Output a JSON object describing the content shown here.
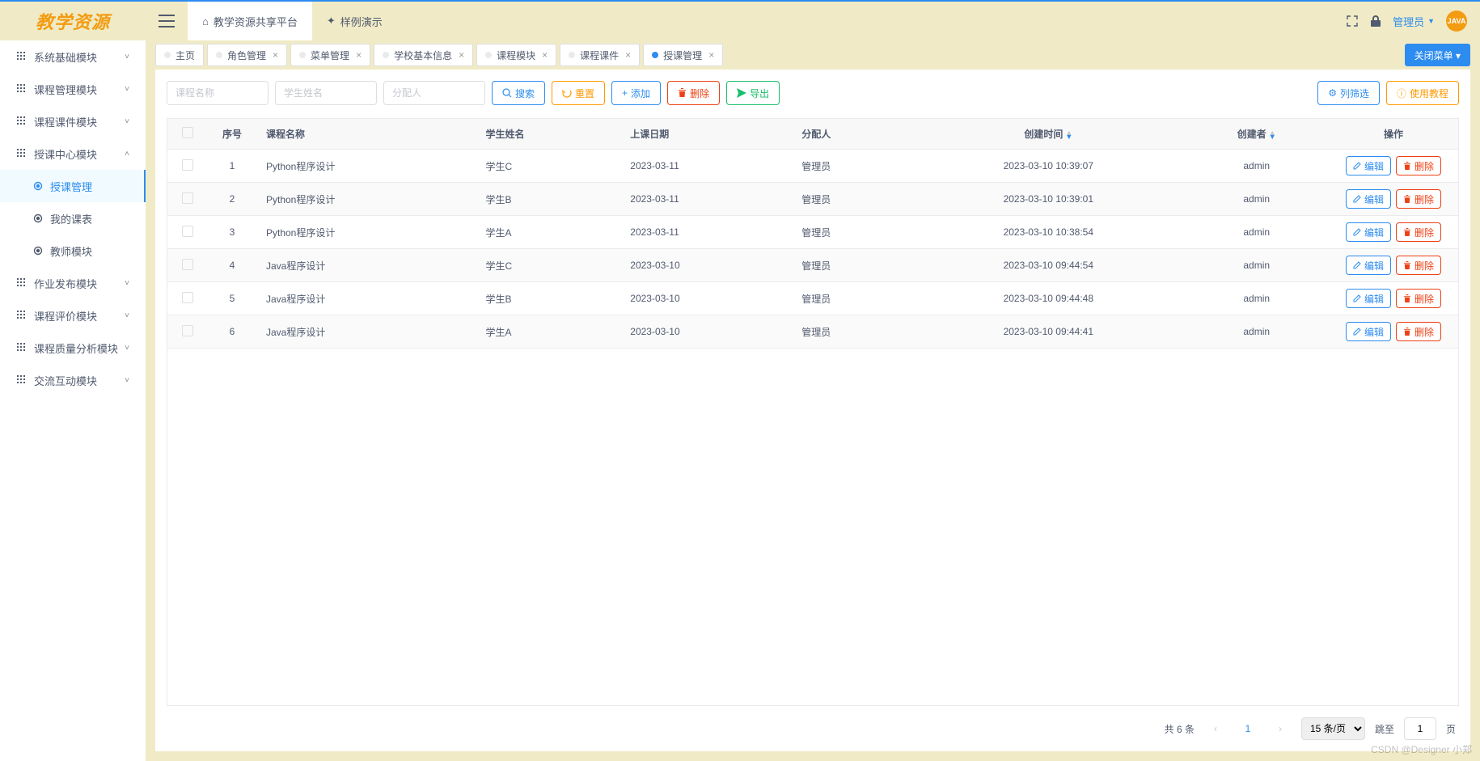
{
  "logo": "教学资源",
  "header": {
    "platform": "教学资源共享平台",
    "demo": "样例演示",
    "user": "管理员",
    "avatar_text": "JAVA"
  },
  "sidebar": {
    "items": [
      {
        "label": "系统基础模块",
        "expanded": false
      },
      {
        "label": "课程管理模块",
        "expanded": false
      },
      {
        "label": "课程课件模块",
        "expanded": false
      },
      {
        "label": "授课中心模块",
        "expanded": true,
        "children": [
          {
            "label": "授课管理",
            "active": true
          },
          {
            "label": "我的课表",
            "active": false
          },
          {
            "label": "教师模块",
            "active": false
          }
        ]
      },
      {
        "label": "作业发布模块",
        "expanded": false
      },
      {
        "label": "课程评价模块",
        "expanded": false
      },
      {
        "label": "课程质量分析模块",
        "expanded": false
      },
      {
        "label": "交流互动模块",
        "expanded": false
      }
    ]
  },
  "tabs": [
    {
      "label": "主页",
      "closable": false,
      "active": false
    },
    {
      "label": "角色管理",
      "closable": true,
      "active": false
    },
    {
      "label": "菜单管理",
      "closable": true,
      "active": false
    },
    {
      "label": "学校基本信息",
      "closable": true,
      "active": false
    },
    {
      "label": "课程模块",
      "closable": true,
      "active": false
    },
    {
      "label": "课程课件",
      "closable": true,
      "active": false
    },
    {
      "label": "授课管理",
      "closable": true,
      "active": true
    }
  ],
  "close_menu_btn": "关闭菜单 ▾",
  "toolbar": {
    "course_ph": "课程名称",
    "student_ph": "学生姓名",
    "assignee_ph": "分配人",
    "search": "搜索",
    "reset": "重置",
    "add": "添加",
    "delete": "删除",
    "export": "导出",
    "columns": "列筛选",
    "tutorial": "使用教程"
  },
  "table": {
    "headers": {
      "seq": "序号",
      "course": "课程名称",
      "student": "学生姓名",
      "date": "上课日期",
      "assignee": "分配人",
      "created_at": "创建时间",
      "creator": "创建者",
      "ops": "操作"
    },
    "row_ops": {
      "edit": "编辑",
      "delete": "删除"
    },
    "rows": [
      {
        "seq": "1",
        "course": "Python程序设计",
        "student": "学生C",
        "date": "2023-03-11",
        "assignee": "管理员",
        "created_at": "2023-03-10 10:39:07",
        "creator": "admin"
      },
      {
        "seq": "2",
        "course": "Python程序设计",
        "student": "学生B",
        "date": "2023-03-11",
        "assignee": "管理员",
        "created_at": "2023-03-10 10:39:01",
        "creator": "admin"
      },
      {
        "seq": "3",
        "course": "Python程序设计",
        "student": "学生A",
        "date": "2023-03-11",
        "assignee": "管理员",
        "created_at": "2023-03-10 10:38:54",
        "creator": "admin"
      },
      {
        "seq": "4",
        "course": "Java程序设计",
        "student": "学生C",
        "date": "2023-03-10",
        "assignee": "管理员",
        "created_at": "2023-03-10 09:44:54",
        "creator": "admin"
      },
      {
        "seq": "5",
        "course": "Java程序设计",
        "student": "学生B",
        "date": "2023-03-10",
        "assignee": "管理员",
        "created_at": "2023-03-10 09:44:48",
        "creator": "admin"
      },
      {
        "seq": "6",
        "course": "Java程序设计",
        "student": "学生A",
        "date": "2023-03-10",
        "assignee": "管理员",
        "created_at": "2023-03-10 09:44:41",
        "creator": "admin"
      }
    ]
  },
  "pager": {
    "total_text": "共 6 条",
    "page": "1",
    "size": "15 条/页",
    "jump_label": "跳至",
    "jump_val": "1",
    "jump_suffix": "页"
  },
  "watermark": "CSDN @Designer 小郑"
}
